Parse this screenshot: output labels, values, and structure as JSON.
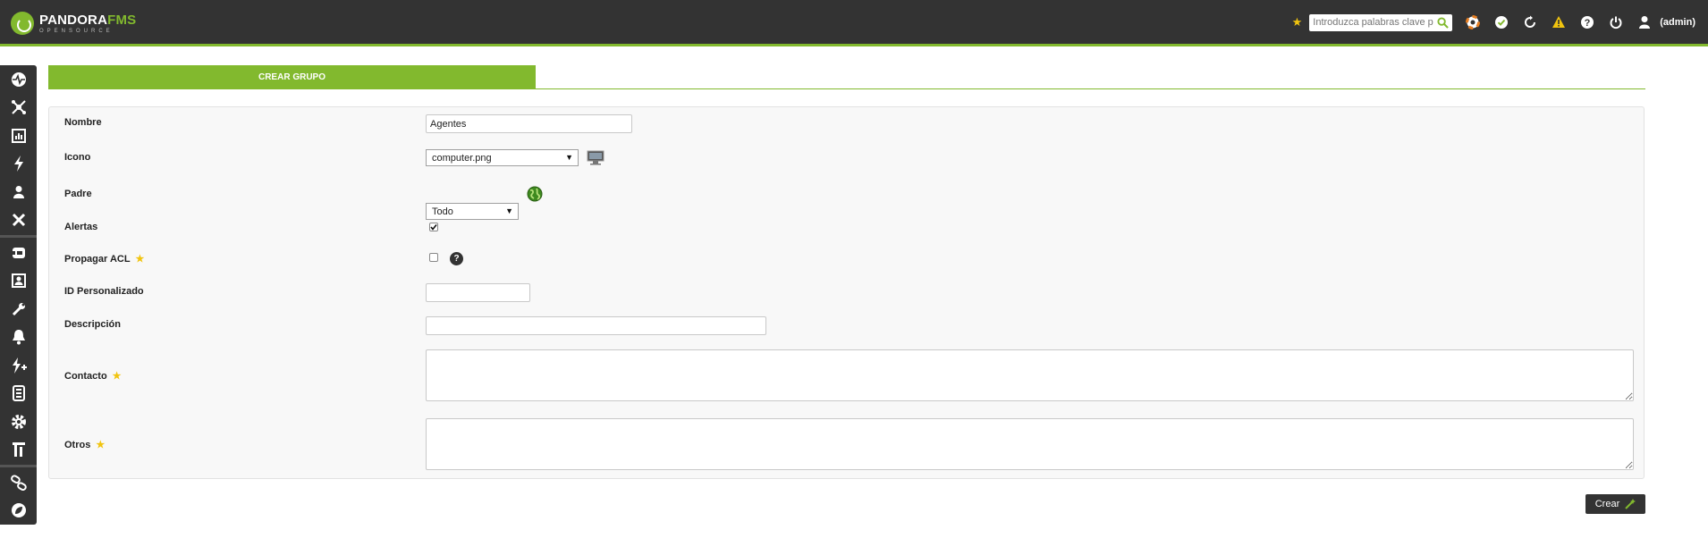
{
  "header": {
    "logo_primary": "PANDORA",
    "logo_secondary": "FMS",
    "logo_sub": "OPENSOURCE",
    "search_placeholder": "Introduzca palabras clave p",
    "user_label": "(admin)",
    "icons": [
      "favorite-star-icon",
      "search-icon",
      "lifebuoy-icon",
      "check-circle-icon",
      "refresh-icon",
      "warning-icon",
      "help-icon",
      "power-icon",
      "user-icon"
    ]
  },
  "sidebar": {
    "icons": [
      "monitoring-icon",
      "network-icon",
      "reports-icon",
      "events-icon",
      "user-icon",
      "tools-icon",
      "resources-icon",
      "profiles-icon",
      "setup-wrench-icon",
      "alerts-bell-icon",
      "servers-icon",
      "module-icon",
      "settings-gear-icon",
      "extensions-icon",
      "links-icon",
      "pandora-logo-icon"
    ]
  },
  "tab": {
    "label": "CREAR GRUPO"
  },
  "form": {
    "nombre": {
      "label": "Nombre",
      "value": "Agentes"
    },
    "icono": {
      "label": "Icono",
      "value": "computer.png"
    },
    "padre": {
      "label": "Padre",
      "value": "Todo"
    },
    "alertas": {
      "label": "Alertas",
      "checked": true
    },
    "propagar": {
      "label": "Propagar ACL",
      "checked": false
    },
    "id_personalizado": {
      "label": "ID Personalizado",
      "value": ""
    },
    "descripcion": {
      "label": "Descripción",
      "value": ""
    },
    "contacto": {
      "label": "Contacto",
      "value": ""
    },
    "otros": {
      "label": "Otros",
      "value": ""
    }
  },
  "actions": {
    "create_label": "Crear"
  },
  "colors": {
    "accent": "#82b92e",
    "dark": "#333333",
    "star": "#f1c40f"
  }
}
